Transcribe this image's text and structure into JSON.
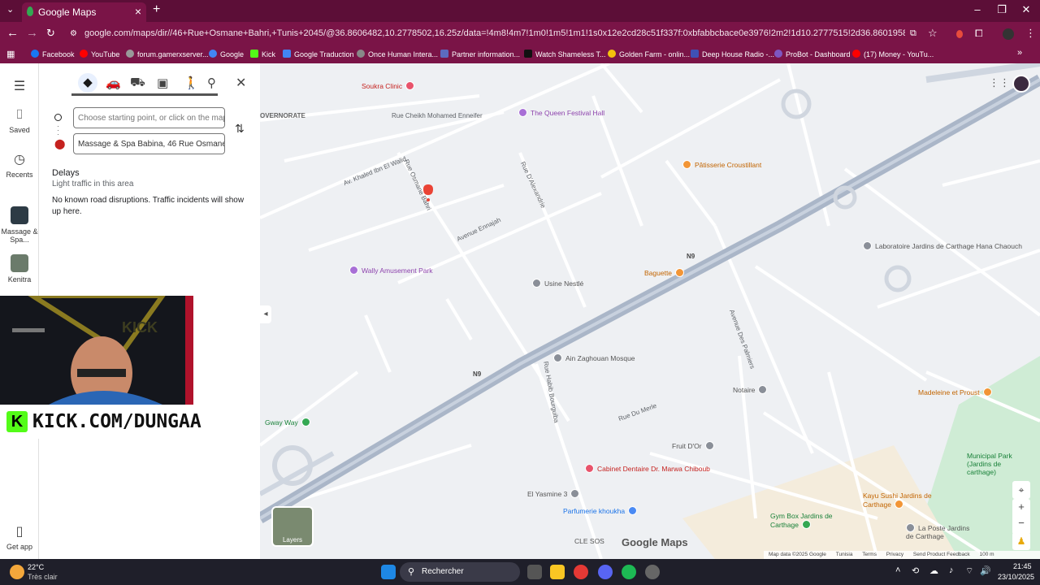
{
  "browser": {
    "tab_title": "Google Maps",
    "url": "google.com/maps/dir//46+Rue+Osmane+Bahri,+Tunis+2045/@36.8606482,10.2778502,16.25z/data=!4m8!4m7!1m0!1m5!1m1!1s0x12e2cd28c51f337f:0xbfabbcbace0e3976!2m2!1d10.2777515!2d36.8601958?entry=ttu&g_ep=EgoyMDI1MTAyM...",
    "bookmarks": [
      {
        "label": "Facebook",
        "color": "#1877f2"
      },
      {
        "label": "YouTube",
        "color": "#ff0000"
      },
      {
        "label": "forum.gamerxserver...",
        "color": "#999999"
      },
      {
        "label": "Google",
        "color": "#4285f4"
      },
      {
        "label": "Kick",
        "color": "#53fc18"
      },
      {
        "label": "Google Traduction",
        "color": "#4285f4"
      },
      {
        "label": "Once Human Intera...",
        "color": "#888888"
      },
      {
        "label": "Partner information...",
        "color": "#5c6bc0"
      },
      {
        "label": "Watch Shameless T...",
        "color": "#111111"
      },
      {
        "label": "Golden Farm - onlin...",
        "color": "#f4c20d"
      },
      {
        "label": "Deep House Radio -...",
        "color": "#3f51b5"
      },
      {
        "label": "ProBot - Dashboard",
        "color": "#7e57c2"
      },
      {
        "label": "(17) Money - YouTu...",
        "color": "#ff0000"
      }
    ]
  },
  "rail": {
    "saved": "Saved",
    "recents": "Recents",
    "recent1": "Massage & Spa...",
    "recent2": "Kenitra",
    "get_app": "Get app"
  },
  "directions": {
    "start_placeholder": "Choose starting point, or click on the map...",
    "destination": "Massage & Spa Babina, 46 Rue Osmane Bahri",
    "delays_title": "Delays",
    "delays_sub": "Light traffic in this area",
    "delays_msg": "No known road disruptions. Traffic incidents will show up here."
  },
  "stream": {
    "url": "KICK.COM/DUNGAA"
  },
  "map": {
    "labels": [
      {
        "text": "Rue Cheikh Mohamed Enneifer",
        "type": "street"
      },
      {
        "text": "Av. Khaled Ibn El Walid",
        "type": "street"
      },
      {
        "text": "Rue Osmane Bahri",
        "type": "street"
      },
      {
        "text": "Avenue Ennajah",
        "type": "street"
      },
      {
        "text": "Rue D'Alexandrie",
        "type": "street"
      },
      {
        "text": "Rue Habib Bourguiba",
        "type": "street"
      },
      {
        "text": "Avenue Des Palmiers",
        "type": "street"
      },
      {
        "text": "Rue Du Merle",
        "type": "street"
      },
      {
        "text": "N9",
        "type": "highway"
      },
      {
        "text": "OVERNORATE",
        "type": "area"
      },
      {
        "text": "Soukra Clinic",
        "type": "poi-red"
      },
      {
        "text": "The Queen Festival Hall",
        "type": "poi-purple"
      },
      {
        "text": "Pâtisserie Croustillant",
        "type": "poi-orange"
      },
      {
        "text": "Wally Amusement Park",
        "type": "poi-purple"
      },
      {
        "text": "Usine Nestlé",
        "type": "poi-gray"
      },
      {
        "text": "Ain Zaghouan Mosque",
        "type": "poi-gray"
      },
      {
        "text": "Baguette",
        "type": "poi-orange"
      },
      {
        "text": "Laboratoire Jardins de Carthage Hana Chaouch",
        "type": "poi-gray"
      },
      {
        "text": "Notaire",
        "type": "poi-gray"
      },
      {
        "text": "Madeleine et Proust",
        "type": "poi-orange"
      },
      {
        "text": "Fruit D'Or",
        "type": "poi-gray"
      },
      {
        "text": "Cabinet Dentaire Dr. Marwa Chiboub",
        "type": "poi-red"
      },
      {
        "text": "El Yasmine 3",
        "type": "poi-gray"
      },
      {
        "text": "Parfumerie khoukha",
        "type": "poi-blue"
      },
      {
        "text": "Gway Way",
        "type": "poi-green"
      },
      {
        "text": "Municipal Park (Jardins de carthage)",
        "type": "poi-green"
      },
      {
        "text": "Kayu Sushi Jardins de Carthage",
        "type": "poi-orange"
      },
      {
        "text": "Gym Box Jardins de Carthage",
        "type": "poi-green"
      },
      {
        "text": "La Poste Jardins de Carthage",
        "type": "poi-gray"
      },
      {
        "text": "CLE SOS",
        "type": "poi-gray"
      }
    ],
    "layers_label": "Layers",
    "watermark": "Google Maps",
    "footer": [
      "Map data ©2025 Google",
      "Tunisia",
      "Terms",
      "Privacy",
      "Send Product Feedback",
      "100 m"
    ]
  },
  "taskbar": {
    "temp": "22°C",
    "weather": "Très clair",
    "search": "Rechercher",
    "time": "21:45",
    "date": "23/10/2025"
  }
}
